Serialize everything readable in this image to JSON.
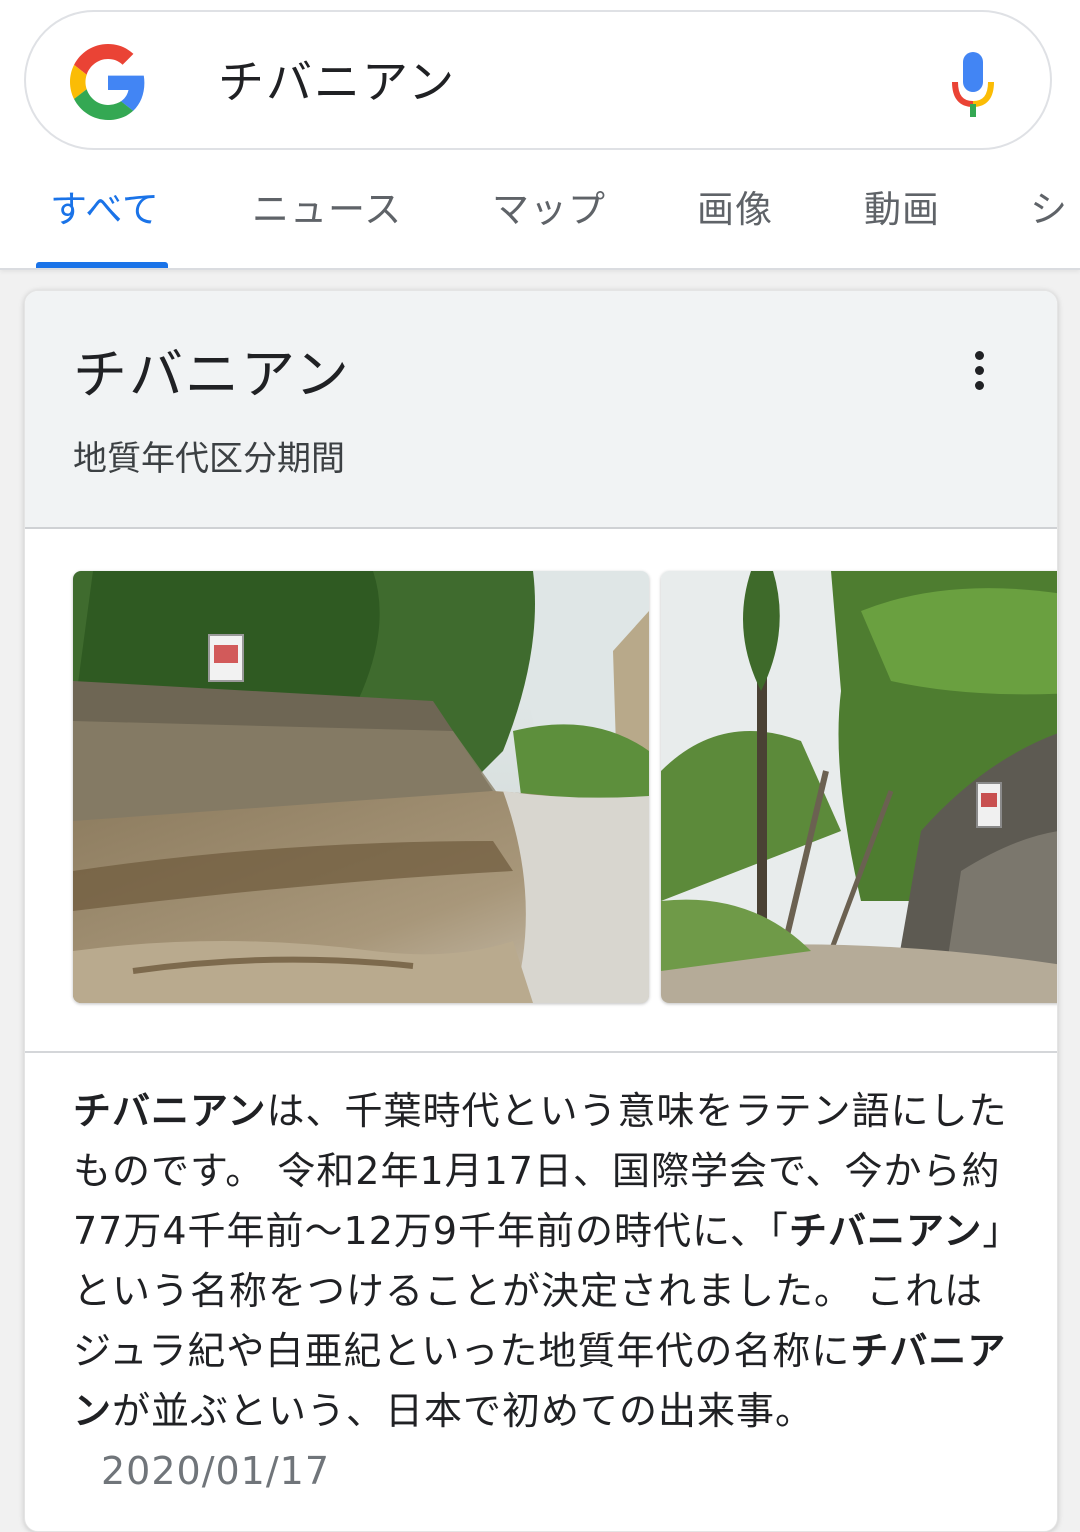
{
  "search": {
    "query": "チバニアン"
  },
  "tabs": [
    {
      "label": "すべて",
      "active": true
    },
    {
      "label": "ニュース",
      "active": false
    },
    {
      "label": "マップ",
      "active": false
    },
    {
      "label": "画像",
      "active": false
    },
    {
      "label": "動画",
      "active": false
    },
    {
      "label": "シ",
      "active": false
    }
  ],
  "card": {
    "title": "チバニアン",
    "subtitle": "地質年代区分期間",
    "description": {
      "p1_bold": "チバニアン",
      "p1": "は、千葉時代という意味をラテン語にしたものです。 令和2年1月17日、国際学会で、今から約77万4千年前〜12万9千年前の時代に、「",
      "p2_bold": "チバニアン",
      "p2": "」という名称をつけることが決定されました。 これはジュラ紀や白亜紀といった地質年代の名称に",
      "p3_bold": "チバニアン",
      "p3": "が並ぶという、日本で初めての出来事。",
      "date": "2020/01/17"
    }
  },
  "colors": {
    "accent": "#1a73e8",
    "google_blue": "#4285f4",
    "google_red": "#ea4335",
    "google_yellow": "#fbbc05",
    "google_green": "#34a853"
  },
  "icons": {
    "logo": "google-g-icon",
    "mic": "mic-icon",
    "more": "more-vert-icon"
  }
}
